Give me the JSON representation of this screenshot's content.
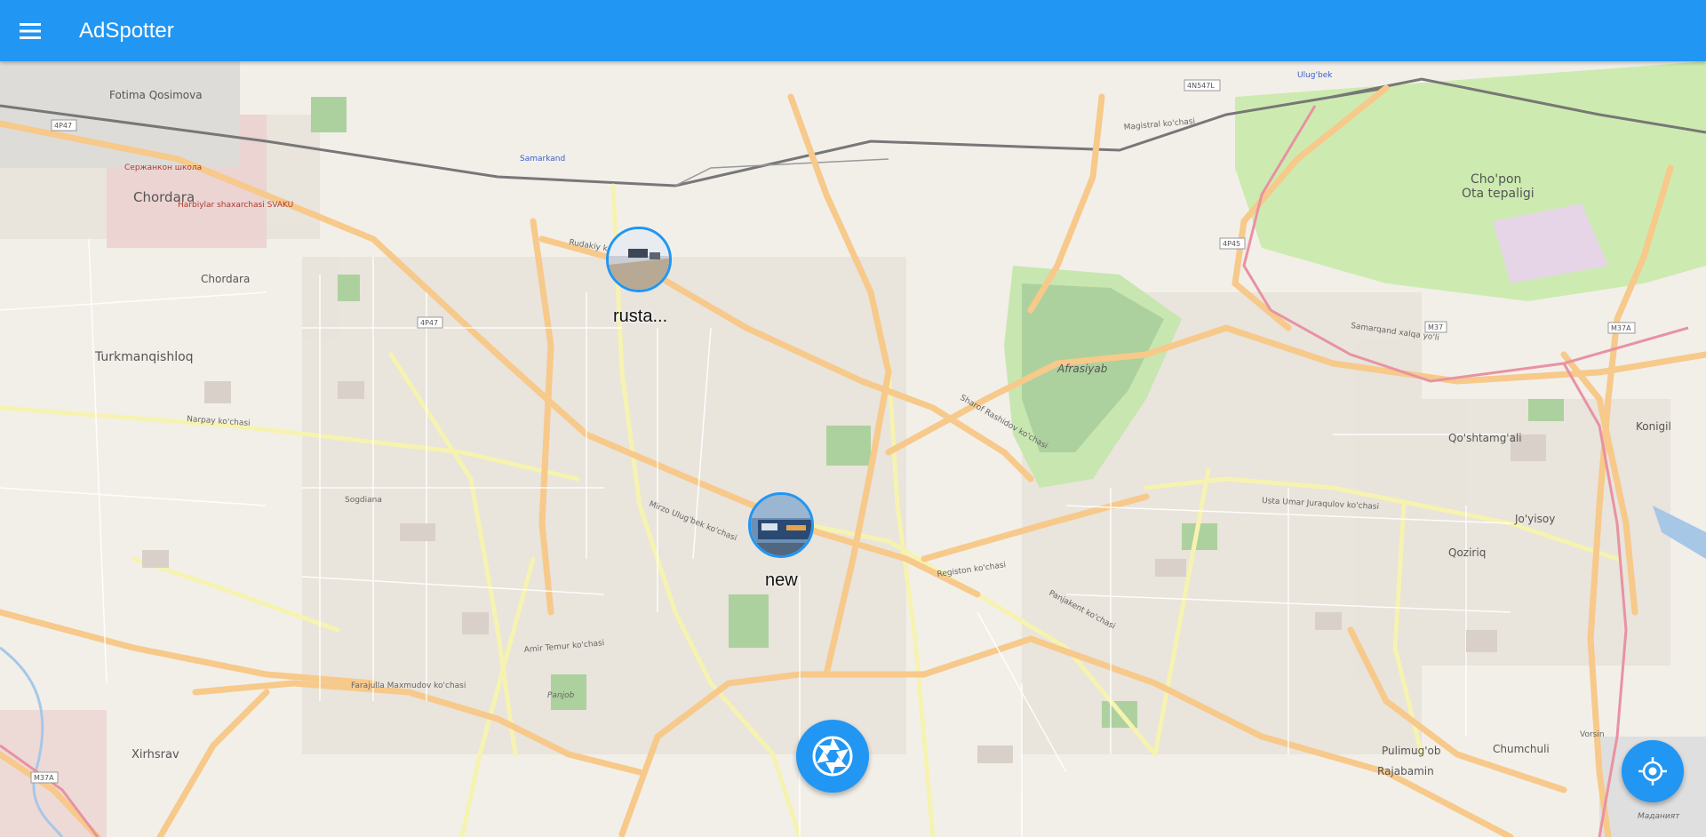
{
  "app": {
    "title": "AdSpotter"
  },
  "markers": [
    {
      "caption": "rusta..."
    },
    {
      "caption": "new"
    }
  ],
  "map_labels": {
    "fotima": "Fotima Qosimova",
    "chordara1": "Chordara",
    "chordara2": "Chordara",
    "turkmanqishloq": "Turkmanqishloq",
    "xirhsrav": "Xirhsrav",
    "samarkand": "Samarkand",
    "chopon": "Cho'pon",
    "ota": "Ota tepaligi",
    "afrasiyab": "Afrasiyab",
    "qoshtamgali": "Qo'shtamg'ali",
    "konigil": "Konigil",
    "joyisoy": "Jo'yisoy",
    "qoziriq": "Qoziriq",
    "pulimugob": "Pulimug'ob",
    "chumchuli": "Chumchuli",
    "rajabamin": "Rajabamin",
    "vorsin": "Vorsin",
    "ulugbek": "Ulug'bek",
    "panjob": "Panjob",
    "sogdiana": "Sogdiana",
    "serjankon": "Сержанкон школа",
    "harbiylar": "Harbiylar shaxarchasi SVAKU",
    "madaniyat": "Маданият",
    "road_narpay": "Narpay ko'chasi",
    "road_rudakiy": "Rudakiy ko'chasi",
    "road_amir": "Amir Temur ko'chasi",
    "road_mirzo": "Mirzo Ulug'bek ko'chasi",
    "road_sharof": "Sharof Rashidov ko'chasi",
    "road_registon": "Registon ko'chasi",
    "road_magistral": "Magistral ko'chasi",
    "road_panjakent": "Panjakent ko'chasi",
    "road_ringroad": "Samarqand xalqa yo'li",
    "road_faraulla": "Farajulla Maxmudov ko'chasi",
    "road_umar": "Usta Umar Juraqulov ko'chasi",
    "shield_4p47": "4P47",
    "shield_4p45": "4P45",
    "shield_m37": "M37",
    "shield_m37a": "M37A",
    "shield_4n547l": "4N547L"
  },
  "colors": {
    "appbar": "#2196f3",
    "map_bg": "#f2efe9",
    "road_major": "#f7c98a",
    "road_secondary": "#f6f3b0",
    "park": "#cdebb0"
  }
}
